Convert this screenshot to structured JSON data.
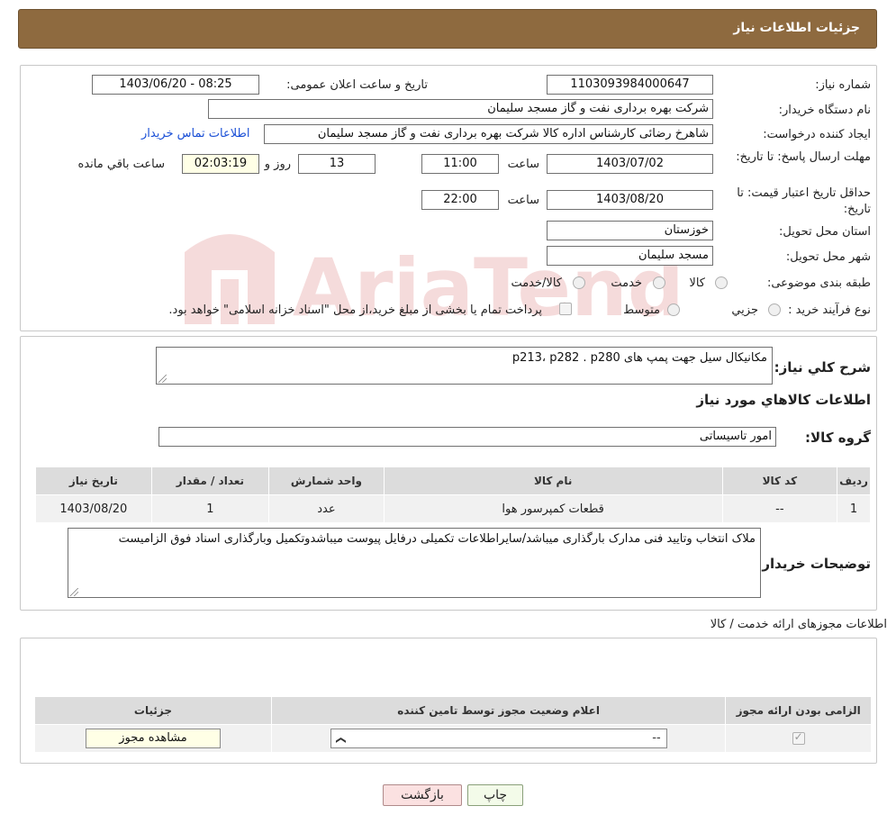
{
  "header": {
    "title": "جزئیات اطلاعات نیاز"
  },
  "form": {
    "need_number_label": "شماره نیاز:",
    "need_number": "1103093984000647",
    "announce_label": "تاریخ و ساعت اعلان عمومی:",
    "announce_value": "1403/06/20 - 08:25",
    "buyer_org_label": "نام دستگاه خریدار:",
    "buyer_org": "شرکت بهره برداری نفت و گاز مسجد سلیمان",
    "creator_label": "ایجاد کننده درخواست:",
    "creator": "شاهرخ رضائی کارشناس اداره کالا شرکت بهره برداری نفت و گاز مسجد سلیمان",
    "contact_link": "اطلاعات تماس خریدار",
    "deadline_label": "مهلت ارسال پاسخ: تا تاریخ:",
    "deadline_date": "1403/07/02",
    "time_label": "ساعت",
    "deadline_time": "11:00",
    "days": "13",
    "days_label": "روز و",
    "remaining": "02:03:19",
    "remaining_label": "ساعت باقي مانده",
    "validity_label": "حداقل تاریخ اعتبار قیمت: تا تاریخ:",
    "validity_date": "1403/08/20",
    "validity_time": "22:00",
    "province_label": "استان محل تحویل:",
    "province": "خوزستان",
    "city_label": "شهر محل تحویل:",
    "city": "مسجد سلیمان",
    "category_label": "طبقه بندی موضوعی:",
    "category_options": [
      "کالا",
      "خدمت",
      "کالا/خدمت"
    ],
    "process_label": "نوع فرآیند خرید :",
    "process_options": [
      "جزيي",
      "متوسط"
    ],
    "process_note": "پرداخت تمام یا بخشی از مبلغ خرید،از محل \"اسناد خزانه اسلامی\" خواهد بود."
  },
  "description": {
    "summary_label": "شرح کلي نياز:",
    "summary": "مکانیکال سیل جهت پمپ های p213، p282 . p280",
    "goods_info_title": "اطلاعات کالاهاي مورد نياز",
    "group_label": "گروه کالا:",
    "group": "امور تاسیساتی",
    "table": {
      "headers": [
        "رديف",
        "کد کالا",
        "نام کالا",
        "واحد شمارش",
        "تعداد / مقدار",
        "تاريخ نياز"
      ],
      "rows": [
        [
          "1",
          "--",
          "قطعات کمپرسور هوا",
          "عدد",
          "1",
          "1403/08/20"
        ]
      ]
    },
    "buyer_notes_label": "توضیحات خریدار:",
    "buyer_notes": "ملاک انتخاب وتایید فنی مدارک بارگذاری میباشد/سایراطلاعات تکمیلی درفایل پیوست میباشدوتکمیل وبارگذاری اسناد فوق الزامیست"
  },
  "licenses": {
    "title": "اطلاعات مجوزهای ارائه خدمت / کالا",
    "headers": [
      "الزامی بودن ارائه مجوز",
      "اعلام وضعیت مجوز توسط تامین کننده",
      "جزئیات"
    ],
    "select_value": "--",
    "view_button": "مشاهده مجوز"
  },
  "actions": {
    "print": "چاپ",
    "back": "بازگشت"
  },
  "watermark": {
    "text": "AriaTender.neT"
  }
}
